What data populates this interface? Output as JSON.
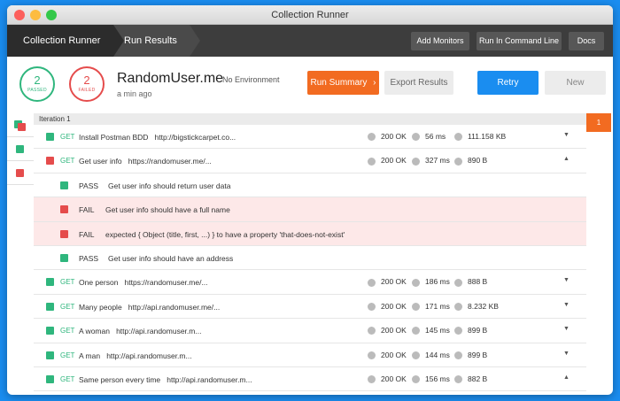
{
  "window": {
    "title": "Collection Runner"
  },
  "nav": {
    "crumbs": [
      "Collection Runner",
      "Run Results"
    ],
    "buttons": [
      "Add Monitors",
      "Run In Command Line",
      "Docs"
    ]
  },
  "summary": {
    "passed": {
      "count": "2",
      "label": "PASSED"
    },
    "failed": {
      "count": "2",
      "label": "FAILED"
    },
    "collection": "RandomUser.me",
    "environment": "No Environment",
    "time_ago": "a min ago",
    "buttons": {
      "run_summary": "Run Summary",
      "export": "Export Results",
      "retry": "Retry",
      "new": "New"
    }
  },
  "iteration": {
    "label": "Iteration 1",
    "number": "1"
  },
  "requests": [
    {
      "status": "pass",
      "method": "GET",
      "name": "Install Postman BDD",
      "url": "http://bigstickcarpet.co...",
      "code": "200 OK",
      "time": "56 ms",
      "size": "111.158 KB",
      "expanded": false
    },
    {
      "status": "fail",
      "method": "GET",
      "name": "Get user info",
      "url": "https://randomuser.me/...",
      "code": "200 OK",
      "time": "327 ms",
      "size": "890 B",
      "expanded": true,
      "tests": [
        {
          "result": "PASS",
          "message": "Get user info should return user data"
        },
        {
          "result": "FAIL",
          "message": "Get user info should have a full name"
        },
        {
          "result": "FAIL",
          "message": "expected { Object (title, first, ...) } to have a property 'that-does-not-exist'"
        },
        {
          "result": "PASS",
          "message": "Get user info should have an address"
        }
      ]
    },
    {
      "status": "pass",
      "method": "GET",
      "name": "One person",
      "url": "https://randomuser.me/...",
      "code": "200 OK",
      "time": "186 ms",
      "size": "888 B",
      "expanded": false
    },
    {
      "status": "pass",
      "method": "GET",
      "name": "Many people",
      "url": "http://api.randomuser.me/...",
      "code": "200 OK",
      "time": "171 ms",
      "size": "8.232 KB",
      "expanded": false
    },
    {
      "status": "pass",
      "method": "GET",
      "name": "A woman",
      "url": "http://api.randomuser.m...",
      "code": "200 OK",
      "time": "145 ms",
      "size": "899 B",
      "expanded": false
    },
    {
      "status": "pass",
      "method": "GET",
      "name": "A man",
      "url": "http://api.randomuser.m...",
      "code": "200 OK",
      "time": "144 ms",
      "size": "899 B",
      "expanded": false
    },
    {
      "status": "pass",
      "method": "GET",
      "name": "Same person every time",
      "url": "http://api.randomuser.m...",
      "code": "200 OK",
      "time": "156 ms",
      "size": "882 B",
      "expanded": true
    }
  ],
  "colors": {
    "pass": "#2fb67d",
    "fail": "#e54c4c",
    "accent": "#f26b21",
    "primary": "#1a8df0"
  },
  "icons": {
    "expand": "chevron-down-icon",
    "collapse": "chevron-up-icon",
    "run_summary": "chevron-right-icon"
  }
}
